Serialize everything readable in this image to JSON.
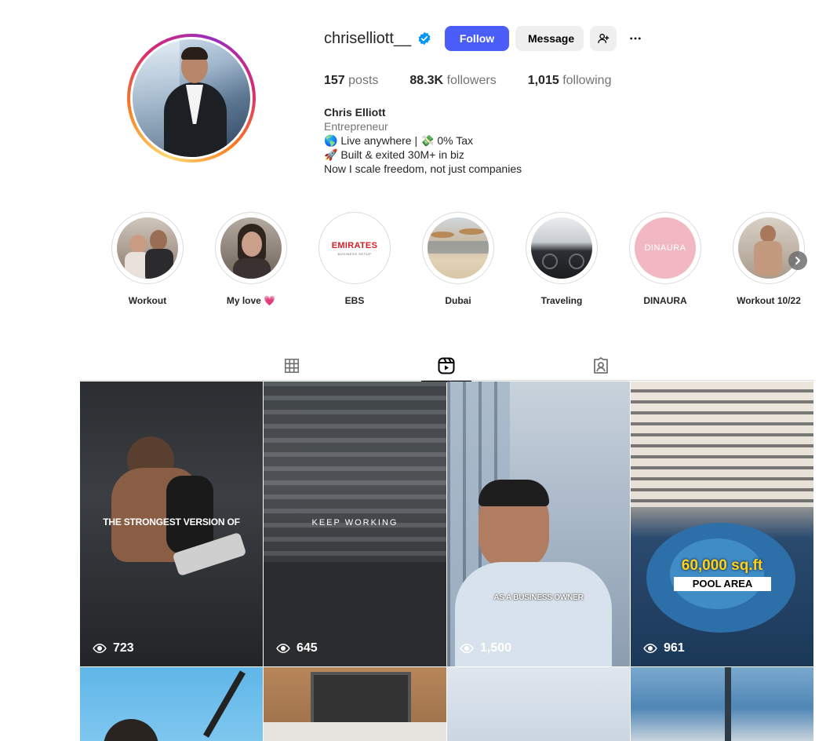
{
  "profile": {
    "username": "chriselliott__",
    "follow_label": "Follow",
    "message_label": "Message",
    "stats": {
      "posts_count": "157",
      "posts_label": "posts",
      "followers_count": "88.3K",
      "followers_label": "followers",
      "following_count": "1,015",
      "following_label": "following"
    },
    "bio": {
      "name": "Chris Elliott",
      "category": "Entrepreneur",
      "line1": "🌎 Live anywhere | 💸 0% Tax",
      "line2": "🚀 Built & exited 30M+ in biz",
      "line3": "Now I scale freedom, not just companies"
    }
  },
  "highlights": [
    {
      "label": "Workout"
    },
    {
      "label": "My love 💗"
    },
    {
      "label": "EBS"
    },
    {
      "label": "Dubai"
    },
    {
      "label": "Traveling"
    },
    {
      "label": "DINAURA"
    },
    {
      "label": "Workout 10/22"
    }
  ],
  "highlight_art": {
    "ebs_main": "EMIRATES",
    "ebs_sub": "BUSINESS SETUP",
    "dinaura_main": "DINAURA"
  },
  "tabs": [
    "grid-icon",
    "reels-icon",
    "tagged-icon"
  ],
  "active_tab": "reels",
  "reels": [
    {
      "overlay": "THE STRONGEST VERSION OF",
      "views": "723"
    },
    {
      "overlay": "KEEP WORKING",
      "views": "645"
    },
    {
      "overlay": "AS A BUSINESS OWNER",
      "views": "1,500"
    },
    {
      "overlay_top": "60,000 sq.ft",
      "overlay_bottom": "POOL AREA",
      "views": "961"
    }
  ],
  "colors": {
    "follow_button": "#4a5df9",
    "verified_badge": "#0095f6",
    "secondary_button": "#efefef"
  }
}
